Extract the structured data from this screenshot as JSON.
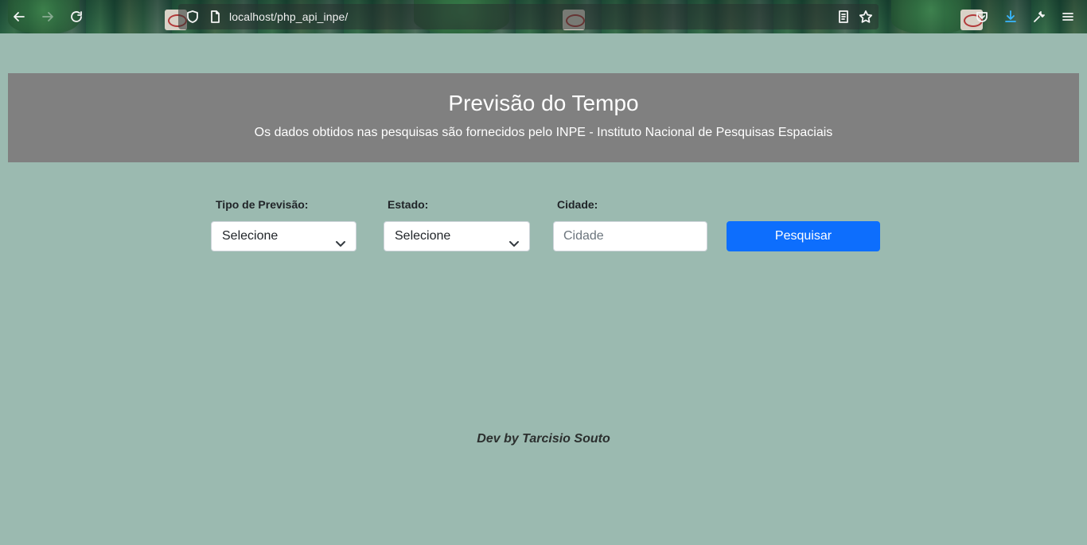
{
  "browser": {
    "url": "localhost/php_api_inpe/",
    "icons": {
      "back": "arrow-left-icon",
      "forward": "arrow-right-icon",
      "reload": "reload-icon",
      "shield": "shield-icon",
      "page": "page-icon",
      "reader": "reader-view-icon",
      "bookmark": "star-icon",
      "pocket": "pocket-icon",
      "downloads": "download-icon",
      "customize": "wrench-icon",
      "menu": "hamburger-menu-icon"
    }
  },
  "header": {
    "title": "Previsão do Tempo",
    "subtitle": "Os dados obtidos nas pesquisas são fornecidos pelo INPE - Instituto Nacional de Pesquisas Espaciais"
  },
  "form": {
    "tipo_label": "Tipo de Previsão:",
    "tipo_selected": "Selecione",
    "estado_label": "Estado:",
    "estado_selected": "Selecione",
    "cidade_label": "Cidade:",
    "cidade_placeholder": "Cidade",
    "cidade_value": "",
    "submit_label": "Pesquisar"
  },
  "footer": {
    "credit": "Dev by Tarcisio Souto"
  },
  "colors": {
    "page_background": "#9bbab0",
    "banner_background": "#808080",
    "button_primary": "#0d6efd"
  }
}
